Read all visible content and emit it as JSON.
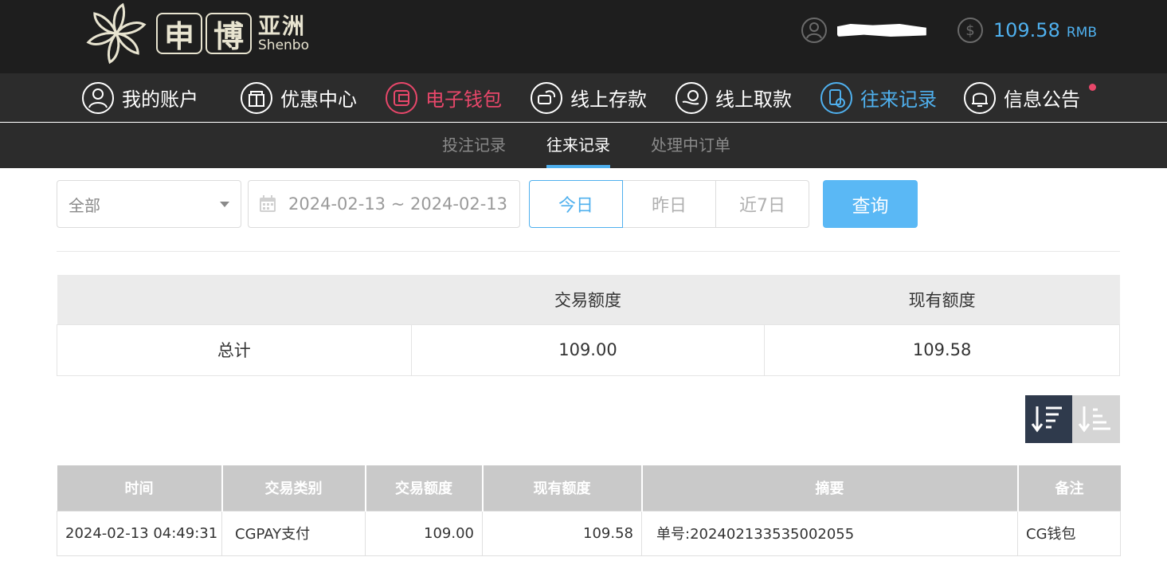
{
  "brand": {
    "char1": "申",
    "char2": "博",
    "name_cn": "亚洲",
    "name_en": "Shenbo"
  },
  "account": {
    "balance": "109.58",
    "currency": "RMB"
  },
  "main_nav": [
    {
      "label": "我的账户",
      "icon": "user-icon"
    },
    {
      "label": "优惠中心",
      "icon": "gift-icon"
    },
    {
      "label": "电子钱包",
      "icon": "wallet-icon",
      "state": "highlighted",
      "color": "#e8476a"
    },
    {
      "label": "线上存款",
      "icon": "deposit-icon"
    },
    {
      "label": "线上取款",
      "icon": "withdraw-icon"
    },
    {
      "label": "往来记录",
      "icon": "records-icon",
      "state": "active",
      "color": "#4fb0ee"
    },
    {
      "label": "信息公告",
      "icon": "bell-icon",
      "badge": "unread-dot"
    }
  ],
  "sub_nav": [
    {
      "label": "投注记录"
    },
    {
      "label": "往来记录",
      "active": true
    },
    {
      "label": "处理中订单"
    }
  ],
  "filters": {
    "type_value": "全部",
    "date_range": "2024-02-13 ~ 2024-02-13",
    "quick_ranges": [
      "今日",
      "昨日",
      "近7日"
    ],
    "selected_quick": "今日",
    "query_label": "查询"
  },
  "summary": {
    "headers": [
      "",
      "交易额度",
      "现有额度"
    ],
    "row": {
      "label": "总计",
      "amount": "109.00",
      "balance": "109.58"
    }
  },
  "records": {
    "headers": [
      "时间",
      "交易类别",
      "交易额度",
      "现有额度",
      "摘要",
      "备注"
    ],
    "rows": [
      {
        "time": "2024-02-13 04:49:31",
        "type": "CGPAY支付",
        "amount": "109.00",
        "balance": "109.58",
        "summary": "单号:202402133535002055",
        "note": "CG钱包"
      }
    ]
  },
  "colors": {
    "accent_blue": "#4fb0ee",
    "accent_red": "#e8476a",
    "header_bg": "#1e1e1e",
    "nav_bg": "#2c2c2c",
    "query_button": "#5ab8f5"
  }
}
